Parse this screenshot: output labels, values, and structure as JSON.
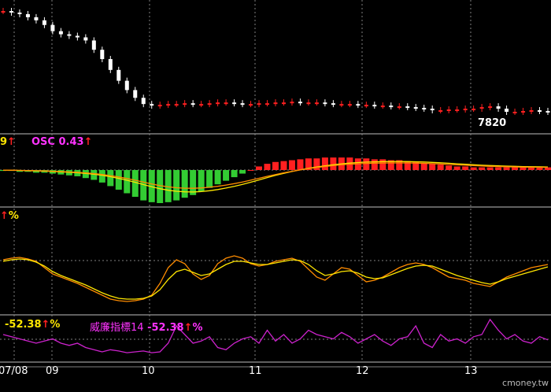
{
  "panel1": {
    "price_label": "7820"
  },
  "panel2": {
    "value_prefix": "9",
    "osc_label": "OSC 0.43"
  },
  "panel3": {
    "percent_label": "%"
  },
  "panel4": {
    "value_left": "-52.38",
    "percent_left": "%",
    "indicator_name": "威廉指標14",
    "indicator_value": "-52.38",
    "percent_right": "%"
  },
  "arrow_glyph": "↑",
  "x_axis": {
    "ticks": [
      "07/08",
      "09",
      "10",
      "11",
      "12",
      "13"
    ]
  },
  "brand": "cmoney.tw",
  "colors": {
    "up_candle": "#ff2020",
    "down_candle": "#ffffff",
    "osc_positive": "#ff2020",
    "osc_negative": "#33cc33",
    "macd_line": "#ffe600",
    "signal_line": "#ff8c00",
    "k_line": "#ff8c00",
    "d_line": "#ffe600",
    "williams_line": "#cc22cc",
    "grid": "#808080"
  },
  "chart_data": [
    {
      "type": "candlestick",
      "title": "",
      "y_scale": "inverted pixel-relative",
      "last_label": "7820",
      "closes": [
        10,
        12,
        14,
        18,
        22,
        28,
        36,
        40,
        42,
        44,
        48,
        60,
        72,
        86,
        100,
        112,
        122,
        130,
        132,
        131,
        130,
        130,
        129,
        130,
        130,
        129,
        128,
        128,
        129,
        130,
        130,
        129,
        129,
        128,
        128,
        127,
        128,
        128,
        128,
        129,
        130,
        130,
        130,
        131,
        131,
        132,
        132,
        133,
        133,
        134,
        135,
        136,
        138,
        138,
        137,
        137,
        136,
        136,
        134,
        133,
        136,
        140,
        140,
        139,
        138,
        139,
        140
      ]
    },
    {
      "type": "bar",
      "title": "",
      "name": "OSC",
      "values": [
        -1,
        -1,
        -2,
        -2,
        -3,
        -3,
        -4,
        -5,
        -6,
        -7,
        -9,
        -11,
        -14,
        -18,
        -22,
        -26,
        -30,
        -34,
        -36,
        -37,
        -36,
        -34,
        -31,
        -28,
        -24,
        -20,
        -16,
        -12,
        -8,
        -4,
        0,
        4,
        7,
        9,
        10,
        11,
        12,
        13,
        13,
        14,
        14,
        14,
        14,
        13,
        13,
        12,
        12,
        11,
        11,
        10,
        9,
        8,
        7,
        6,
        5,
        4,
        4,
        3,
        3,
        3,
        3,
        3,
        3,
        3,
        3,
        3,
        3
      ]
    },
    {
      "type": "line",
      "title": "",
      "series": [
        {
          "values": [
            40,
            38,
            37,
            39,
            42,
            50,
            58,
            62,
            66,
            70,
            75,
            80,
            85,
            90,
            92,
            93,
            92,
            90,
            85,
            70,
            50,
            40,
            45,
            58,
            65,
            60,
            45,
            38,
            35,
            38,
            45,
            48,
            46,
            42,
            40,
            38,
            42,
            52,
            62,
            66,
            58,
            50,
            52,
            60,
            68,
            66,
            62,
            56,
            50,
            46,
            44,
            46,
            50,
            56,
            62,
            64,
            66,
            70,
            72,
            74,
            68,
            62,
            58,
            54,
            50,
            48,
            46
          ]
        },
        {
          "values": [
            42,
            40,
            39,
            40,
            43,
            48,
            55,
            60,
            64,
            68,
            72,
            77,
            82,
            86,
            89,
            90,
            90,
            89,
            86,
            78,
            65,
            55,
            52,
            56,
            60,
            58,
            52,
            46,
            42,
            42,
            44,
            46,
            46,
            44,
            42,
            40,
            41,
            46,
            54,
            60,
            58,
            55,
            54,
            57,
            62,
            64,
            63,
            59,
            55,
            51,
            48,
            47,
            48,
            52,
            56,
            60,
            63,
            66,
            69,
            71,
            68,
            64,
            61,
            58,
            55,
            52,
            49
          ]
        }
      ]
    },
    {
      "type": "line",
      "title": "",
      "name": "威廉指標14",
      "last_value": -52.38,
      "values": [
        -40,
        -45,
        -50,
        -55,
        -60,
        -55,
        -50,
        -60,
        -65,
        -60,
        -70,
        -75,
        -80,
        -75,
        -78,
        -82,
        -80,
        -78,
        -82,
        -80,
        -60,
        -20,
        -40,
        -60,
        -55,
        -45,
        -70,
        -75,
        -60,
        -50,
        -45,
        -60,
        -30,
        -55,
        -40,
        -60,
        -50,
        -30,
        -40,
        -45,
        -50,
        -35,
        -45,
        -60,
        -50,
        -40,
        -55,
        -65,
        -50,
        -45,
        -20,
        -60,
        -70,
        -40,
        -55,
        -50,
        -60,
        -45,
        -40,
        -5,
        -30,
        -50,
        -40,
        -55,
        -60,
        -45,
        -52.38
      ]
    }
  ]
}
